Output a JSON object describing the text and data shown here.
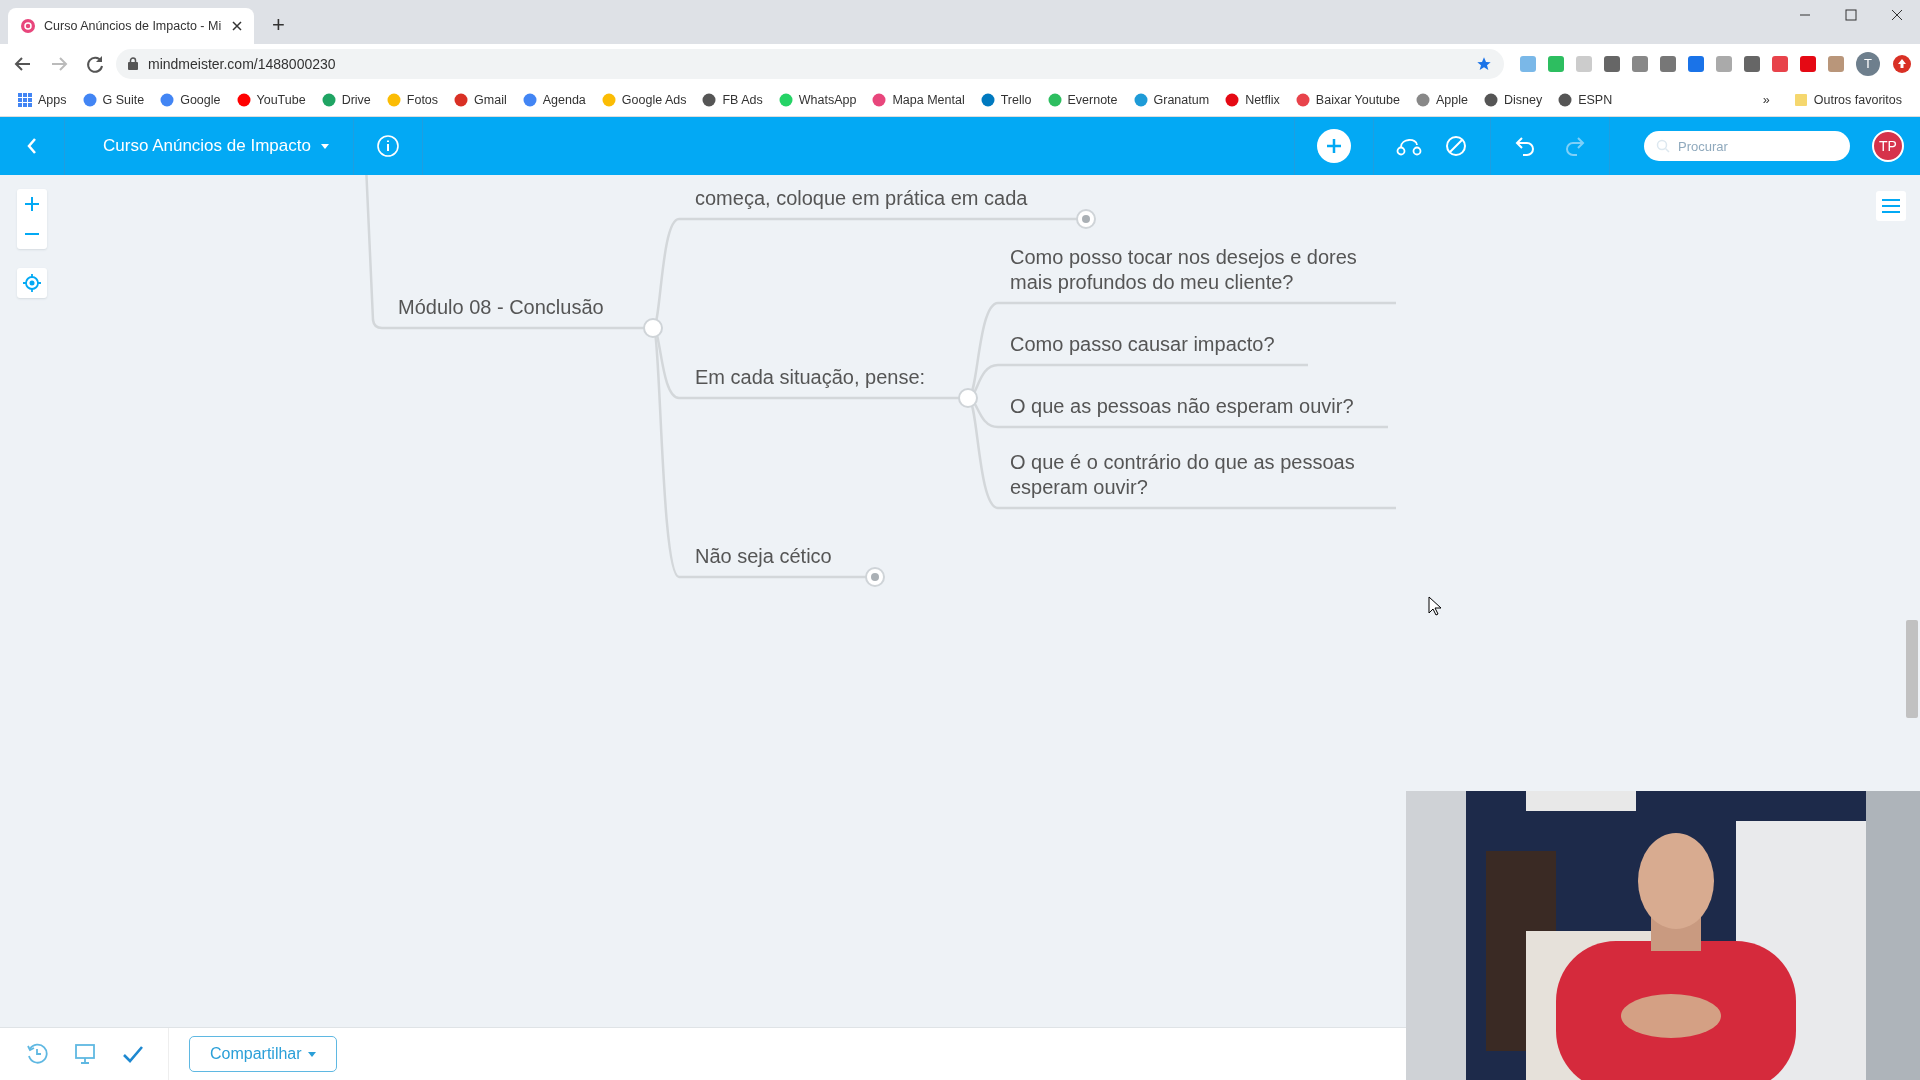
{
  "browser": {
    "tab": {
      "title": "Curso Anúncios de Impacto - Mi",
      "selected": true
    },
    "new_tab": "+",
    "url": "mindmeister.com/1488000230",
    "profile_initial": "T",
    "bookmarks": [
      {
        "label": "Apps",
        "color": "#4285f4"
      },
      {
        "label": "G Suite",
        "color": "#4285f4"
      },
      {
        "label": "Google",
        "color": "#4285f4"
      },
      {
        "label": "YouTube",
        "color": "#ff0000"
      },
      {
        "label": "Drive",
        "color": "#1fa463"
      },
      {
        "label": "Fotos",
        "color": "#fbbc04"
      },
      {
        "label": "Gmail",
        "color": "#d93025"
      },
      {
        "label": "Agenda",
        "color": "#4285f4"
      },
      {
        "label": "Google Ads",
        "color": "#fbbc04"
      },
      {
        "label": "FB Ads",
        "color": "#555555"
      },
      {
        "label": "WhatsApp",
        "color": "#25d366"
      },
      {
        "label": "Mapa Mental",
        "color": "#e8467c"
      },
      {
        "label": "Trello",
        "color": "#0079bf"
      },
      {
        "label": "Evernote",
        "color": "#2dbe60"
      },
      {
        "label": "Granatum",
        "color": "#1e9bd7"
      },
      {
        "label": "Netflix",
        "color": "#e50914"
      },
      {
        "label": "Baixar Youtube",
        "color": "#e8434b"
      },
      {
        "label": "Apple",
        "color": "#888888"
      },
      {
        "label": "Disney",
        "color": "#555555"
      },
      {
        "label": "ESPN",
        "color": "#555555"
      }
    ],
    "more": "»",
    "other_bookmarks": "Outros favoritos"
  },
  "app": {
    "map_title": "Curso Anúncios de Impacto",
    "search": {
      "placeholder": "Procurar"
    },
    "avatar": "TP"
  },
  "mindmap": {
    "text": "Módulo 08 - Conclusão",
    "children": [
      {
        "text": "começa, coloque em prática em cada",
        "collapsed": true
      },
      {
        "text": "Em cada situação, pense:",
        "collapsed": false,
        "children": [
          {
            "text": "Como posso tocar nos desejos e dores mais profundos do meu cliente?"
          },
          {
            "text": "Como passo causar impacto?"
          },
          {
            "text": "O que as pessoas não esperam ouvir?"
          },
          {
            "text": "O que é o contrário do que as pessoas esperam ouvir?"
          }
        ]
      },
      {
        "text": "Não seja cético",
        "collapsed": true
      }
    ]
  },
  "bottom_bar": {
    "share_button": "Compartilhar"
  }
}
